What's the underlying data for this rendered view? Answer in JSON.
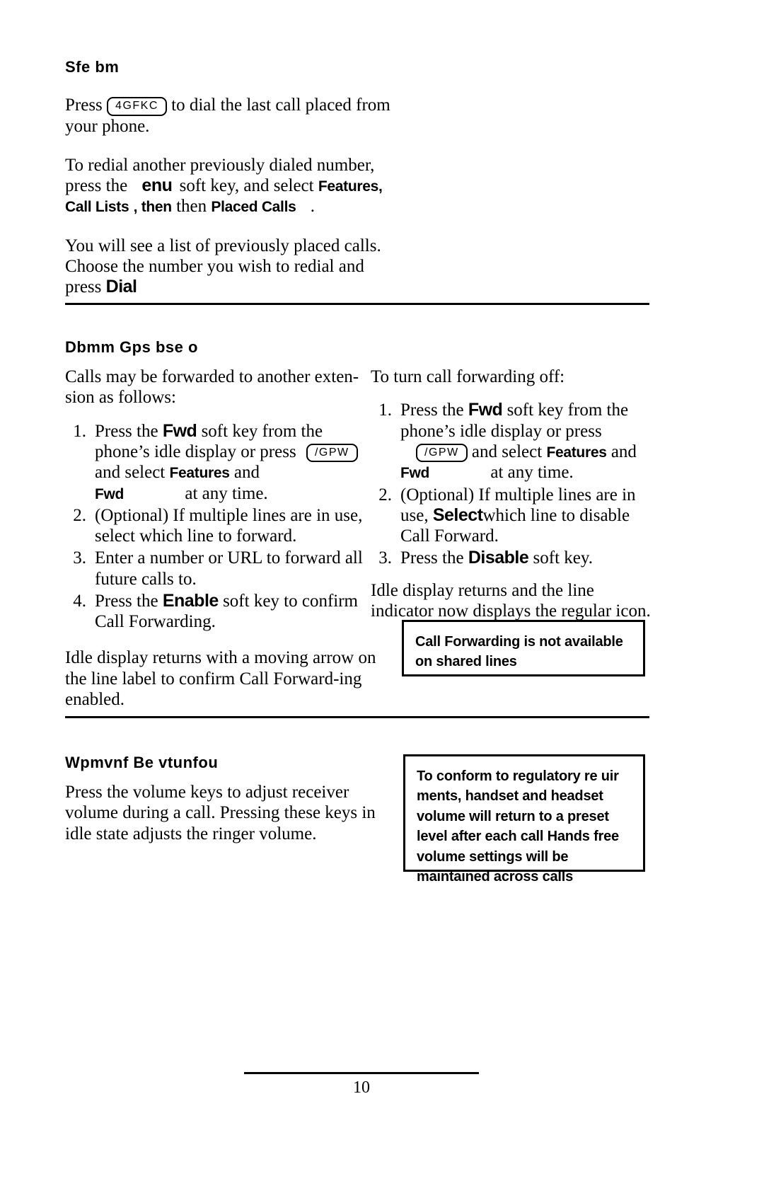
{
  "sections": {
    "redial": {
      "heading": "Sfe   bm",
      "p1_pre": "Press",
      "p1_key": "4GFKC",
      "p1_post": "to dial the last call placed from your phone.",
      "p2_l1": "To redial another previously dialed number,",
      "p2_pre": "press the",
      "p2_key": "enu",
      "p2_mid": "soft key, and select",
      "p2_kw1": "Features,",
      "p2_kw2": "Call Lists",
      "p2_then": ", then",
      "p2_kw3": "Placed Calls",
      "p2_end": ".",
      "p3_l1": "You will see a list of previously placed calls.",
      "p3_l2": "Choose the number you wish to redial and",
      "p3_pre": "press",
      "p3_kw": "Dial"
    },
    "call_forwarding": {
      "heading": "Dbmm   Gps   bse   o",
      "left_intro": "Calls may be forwarded to another exten-sion as follows:",
      "left_steps": [
        {
          "num": "1.",
          "pre": "Press the",
          "kw": "Fwd",
          "mid": "soft key from the phone’s idle display or press",
          "key": "/GPW",
          "mid2": "and select",
          "kw2": "Features",
          "and": "and",
          "kw3": "Fwd",
          "post": "at any time."
        },
        {
          "num": "2.",
          "text": "(Optional) If multiple lines are in use, select which line to forward."
        },
        {
          "num": "3.",
          "text": "Enter a number or URL to forward all future calls to."
        },
        {
          "num": "4.",
          "pre": "Press the",
          "kw": "Enable",
          "post": "soft key to confirm Call Forwarding."
        }
      ],
      "left_outro": "Idle display returns with a moving arrow on the line label to confirm Call Forward-ing enabled.",
      "right_intro": "To turn call forwarding off:",
      "right_steps": [
        {
          "num": "1.",
          "pre": "Press the",
          "kw": "Fwd",
          "mid": "soft key from the phone’s idle display or press",
          "key": "/GPW",
          "mid2": "and select",
          "kw2": "Features",
          "and": "and",
          "kw3": "Fwd",
          "post": "at any time."
        },
        {
          "num": "2.",
          "pre": "(Optional) If multiple lines are in use,",
          "kw": "Select",
          "post": "which line to disable Call Forward."
        },
        {
          "num": "3.",
          "pre": "Press the",
          "kw": "Disable",
          "post": "soft key."
        }
      ],
      "right_outro": "Idle display returns and the line indicator now displays the regular icon.",
      "note": "Call Forwarding is not available on shared lines"
    },
    "volume": {
      "heading": "Wpmvnf   Be   vtunfou",
      "body": "Press the volume keys to adjust receiver volume during a call.  Pressing these keys in idle state adjusts the ringer volume.",
      "note": "To conform to regulatory re   uir  ments, handset and headset volume will return to a preset level after each call    Hands   free volume settings will be maintained across calls"
    }
  },
  "footer": {
    "page_number": "10"
  }
}
